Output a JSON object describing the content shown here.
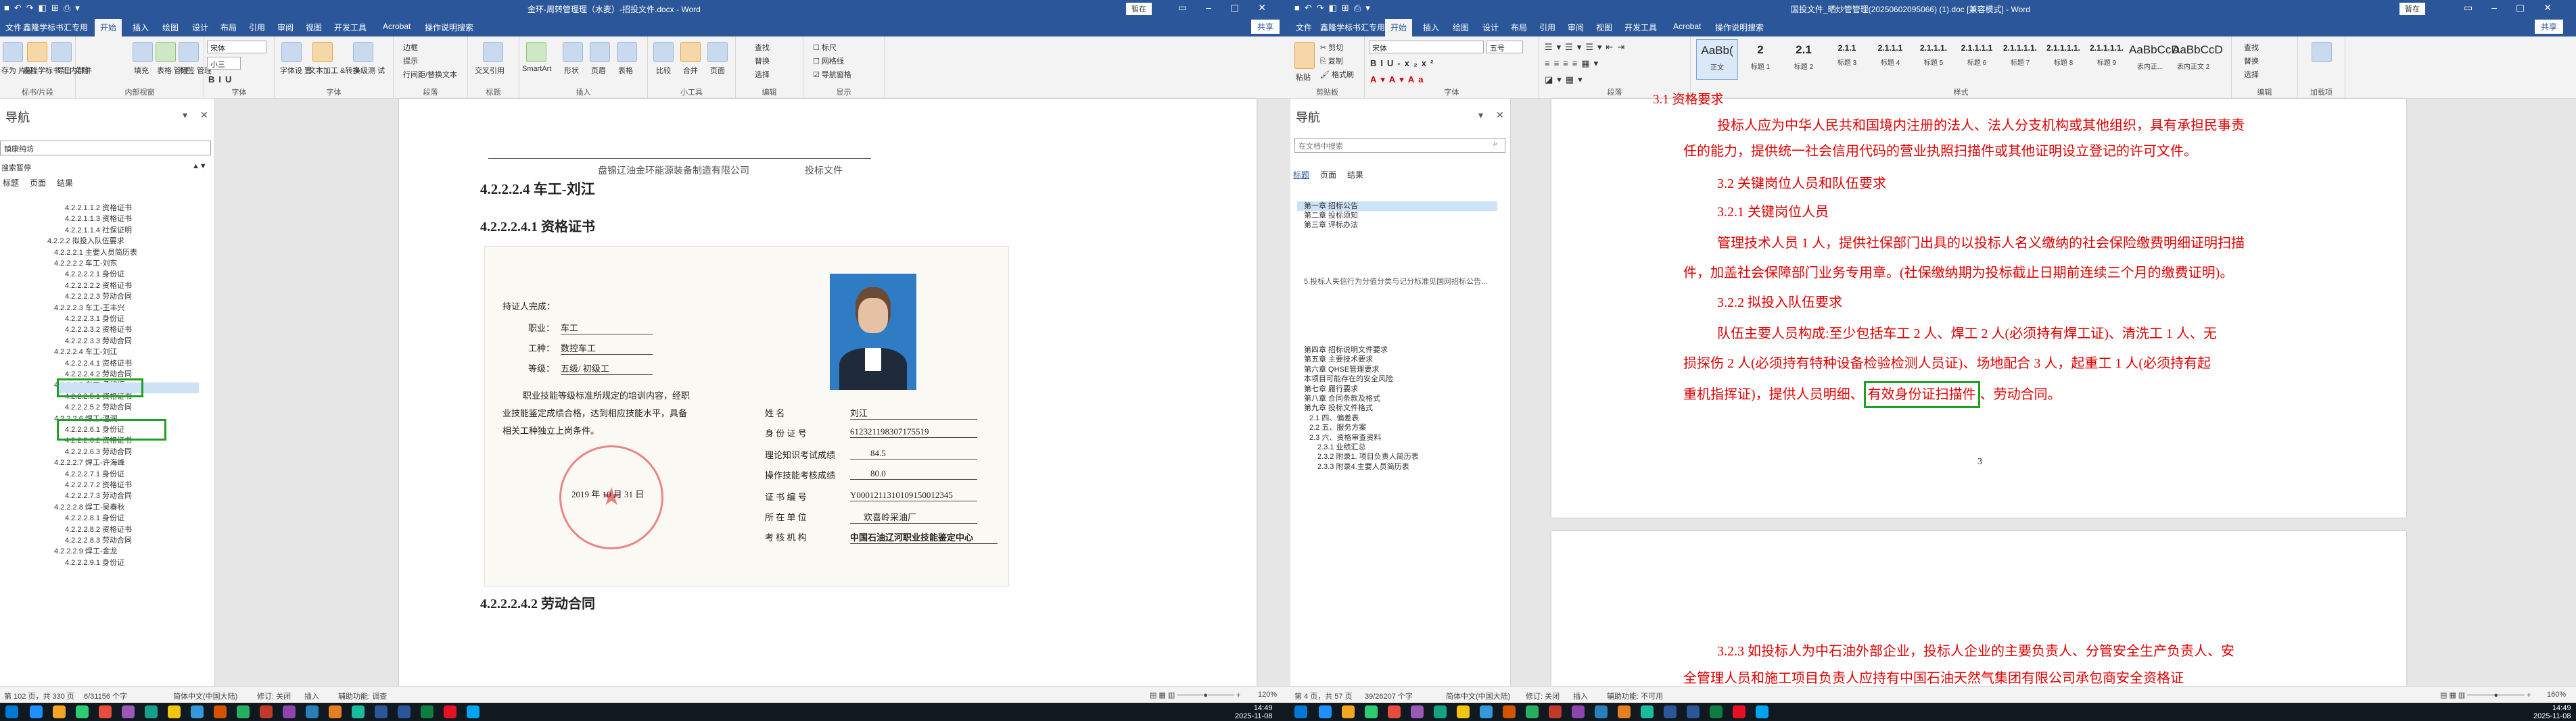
{
  "win1": {
    "title": "金环-周转管理理（水麦）-招投文件.docx - Word",
    "account": "暂在",
    "tabs": [
      "文件",
      "鑫隆学标书汇专用",
      "开始",
      "插入",
      "绘图",
      "设计",
      "布局",
      "引用",
      "审阅",
      "视图",
      "开发工具",
      "Acrobat",
      "操作说明搜索"
    ],
    "share": "共享",
    "ribbon": {
      "g1_label": "标书/片段",
      "g1_btns": [
        "存为\n片段",
        "鑫隆学标书\n汇内部件",
        "导出\n文档"
      ],
      "g2_label": "内部视窗",
      "g2_btns": [
        "填充",
        "表格\n管理",
        "标签\n管理"
      ],
      "g3_label": "字体",
      "font_name": "宋体",
      "font_size": "小三",
      "g4_label": "字体",
      "g4_btns": [
        "字体设\n置",
        "文本加工\n&转换",
        "多级测\n试"
      ],
      "g5_label": "段落",
      "g5_items": [
        "边框",
        "提示",
        "行间距/替换文本"
      ],
      "g6_label": "标题",
      "g6_btns": [
        "交叉引用"
      ],
      "g7_label": "插入",
      "g7_btns": [
        "SmartArt",
        "形状",
        "页眉",
        "表格"
      ],
      "g8_label": "小工具",
      "g8_btns": [
        "比较",
        "合并",
        "页面"
      ],
      "g9_label": "编辑",
      "g9_items": [
        "查找",
        "替换",
        "选择"
      ],
      "g10_label": "显示",
      "g10_items": [
        "标尺",
        "网格线",
        "导航窗格"
      ]
    },
    "nav": {
      "title": "导航",
      "search": "镇康纯坊",
      "subtitle": "搜索暂停",
      "tabs": [
        "标题",
        "页面",
        "结果"
      ],
      "tree": [
        "4.2.2.1.1.2 资格证书",
        "4.2.2.1.1.3 资格证书",
        "4.2.2.1.1.4 社保证明",
        "4.2.2.2 拟投入队伍要求",
        "4.2.2.2.1 主要人员简历表",
        "4.2.2.2.2 车工-刘东",
        "4.2.2.2.2.1 身份证",
        "4.2.2.2.2.2 资格证书",
        "4.2.2.2.2.3 劳动合同",
        "4.2.2.2.3 车工-王丰兴",
        "4.2.2.2.3.1 身份证",
        "4.2.2.2.3.2 资格证书",
        "4.2.2.2.3.3 劳动合同",
        "4.2.2.2.4 车工-刘江",
        "4.2.2.2.4.1 资格证书",
        "4.2.2.2.4.2 劳动合同",
        "4.2.2.2.5 车工-孟纪振",
        "4.2.2.2.5.1 资格证书",
        "4.2.2.2.5.2 劳动合同",
        "4.2.2.2.6 焊工-温润",
        "4.2.2.2.6.1 身份证",
        "4.2.2.2.6.2 资格证书",
        "4.2.2.2.6.3 劳动合同",
        "4.2.2.2.7 焊工-许海峰",
        "4.2.2.2.7.1 身份证",
        "4.2.2.2.7.2 资格证书",
        "4.2.2.2.7.3 劳动合同",
        "4.2.2.2.8 焊工-吴春秋",
        "4.2.2.2.8.1 身份证",
        "4.2.2.2.8.2 资格证书",
        "4.2.2.2.8.3 劳动合同",
        "4.2.2.2.9 焊工-金龙",
        "4.2.2.2.9.1 身份证"
      ]
    },
    "doc": {
      "header_left": "盘锦辽油金环能源装备制造有限公司",
      "header_right": "投标文件",
      "h1": "4.2.2.2.4 车工-刘江",
      "h2": "4.2.2.2.4.1    资格证书",
      "cert": {
        "intro": "持证人完成：",
        "l1": "职业：",
        "v1": "车工",
        "l2": "工种：",
        "v2": "数控车工",
        "l3": "等级：",
        "v3": "五级/ 初级工",
        "desc1": "职业技能等级标准所规定的培训内容，经职",
        "desc2": "业技能鉴定成绩合格，达到相应技能水平，具备",
        "desc3": "相关工种独立上岗条件。",
        "date": "2019 年   10  月  31  日",
        "r1": "姓        名",
        "rv1": "刘江",
        "r2": "身 份 证 号",
        "rv2": "612321198307175519",
        "r3": "理论知识考试成绩",
        "rv3": "84.5",
        "r4": "操作技能考核成绩",
        "rv4": "80.0",
        "r5": "证 书 编 号",
        "rv5": "Y0001211310109150012345",
        "r6": "所 在 单 位",
        "rv6": "欢喜岭采油厂",
        "r7": "考 核 机 构",
        "rv7": "中国石油辽河职业技能鉴定中心"
      },
      "h3": "4.2.2.2.4.2     劳动合同"
    },
    "status": {
      "page": "第 102 页，共 330 页",
      "words": "6/31156 个字",
      "lang": "简体中文(中国大陆)",
      "track": "修订: 关闭",
      "mode": "插入",
      "acc": "辅助功能: 调查",
      "zoom": "120%"
    }
  },
  "win2": {
    "title": "国投文件_晒炒管管理(20250602095066) (1).doc [兼容模式] - Word",
    "account": "暂在",
    "tabs": [
      "文件",
      "鑫隆学标书汇专用",
      "开始",
      "插入",
      "绘图",
      "设计",
      "布局",
      "引用",
      "审阅",
      "视图",
      "开发工具",
      "Acrobat",
      "操作说明搜索"
    ],
    "share": "共享",
    "ribbon": {
      "clip_label": "剪贴板",
      "clip_items": [
        "粘贴",
        "剪切",
        "复制",
        "格式刷"
      ],
      "font_label": "字体",
      "font_name": "宋体",
      "font_size": "五号",
      "para_label": "段落",
      "styles_label": "样式",
      "styles": [
        {
          "p": "AaBb(",
          "n": "正文"
        },
        {
          "p": "2",
          "n": "标题 1"
        },
        {
          "p": "2.1",
          "n": "标题 2"
        },
        {
          "p": "2.1.1",
          "n": "标题 3"
        },
        {
          "p": "2.1.1.1",
          "n": "标题 4"
        },
        {
          "p": "2.1.1.1.",
          "n": "标题 5"
        },
        {
          "p": "2.1.1.1.1",
          "n": "标题 6"
        },
        {
          "p": "2.1.1.1.1.",
          "n": "标题 7"
        },
        {
          "p": "2.1.1.1.1.",
          "n": "标题 8"
        },
        {
          "p": "2.1.1.1.1.",
          "n": "标题 9"
        },
        {
          "p": "AaBbCcD",
          "n": "表内正..."
        },
        {
          "p": "AaBbCcD",
          "n": "表内正文 2"
        }
      ],
      "edit_label": "编辑",
      "edit_items": [
        "查找",
        "替换",
        "选择"
      ],
      "addin_label": "加载项"
    },
    "nav": {
      "title": "导航",
      "search": "在文档中搜索",
      "tabs": [
        "标题",
        "页面",
        "结果"
      ],
      "tree_a": [
        "第一章  招标公告",
        "第二章  投标须知",
        "第三章  评标办法"
      ],
      "note": "5.投标人失信行为分值分类与记分标准见国网招标公告...",
      "tree_b": [
        "第四章  招标说明文件要求",
        "第五章  主要技术要求",
        "第六章  QHSE管理要求",
        "本项目可能存在的安全风险",
        "第七章  履行要求",
        "第八章  合同条款及格式",
        "第九章  投标文件格式",
        "2.1 四、偏差表",
        "2.2 五、服务方案",
        "2.3 六、资格审查资料",
        "2.3.1 业绩汇总",
        "2.3.2 附录1. 项目负责人简历表",
        "2.3.3 附录4.主要人员简历表"
      ]
    },
    "doc": {
      "top": "3.1 资格要求",
      "p1a": "投标人应为中华人民共和国境内注册的法人、法人分支机构或其他组织，具有承担民事责",
      "p1b": "任的能力，提供统一社会信用代码的营业执照扫描件或其他证明设立登记的许可文件。",
      "s32": "3.2 关键岗位人员和队伍要求",
      "s321": "3.2.1 关键岗位人员",
      "p2a": "管理技术人员 1 人，提供社保部门出具的以投标人名义缴纳的社会保险缴费明细证明扫描",
      "p2b": "件，加盖社会保障部门业务专用章。(社保缴纳期为投标截止日期前连续三个月的缴费证明)。",
      "s322": "3.2.2 拟投入队伍要求",
      "p3a": "队伍主要人员构成:至少包括车工 2 人、焊工 2 人(必须持有焊工证)、清洗工 1 人、无",
      "p3b": "损探伤 2 人(必须持有特种设备检验检测人员证)、场地配合 3 人，起重工 1 人(必须持有起",
      "p3c1": "重机指挥证)，提供人员明细、",
      "p3c2": "有效身份证扫描件",
      "p3c3": "、劳动合同。",
      "page_no": "3",
      "p4a": "3.2.3 如投标人为中石油外部企业，投标人企业的主要负责人、分管安全生产负责人、安",
      "p4b": "全管理人员和施工项目负责人应持有中国石油天然气集团有限公司承包商安全资格证"
    },
    "status": {
      "page": "第 4 页，共 57 页",
      "words": "39/26207 个字",
      "lang": "简体中文(中国大陆)",
      "track": "修订: 关闭",
      "mode": "插入",
      "acc": "辅助功能: 不可用",
      "zoom": "160%"
    }
  },
  "taskbar": {
    "time1": "14:49",
    "date1": "2025-11-08",
    "time2": "14:49",
    "date2": "2025-11-08"
  }
}
